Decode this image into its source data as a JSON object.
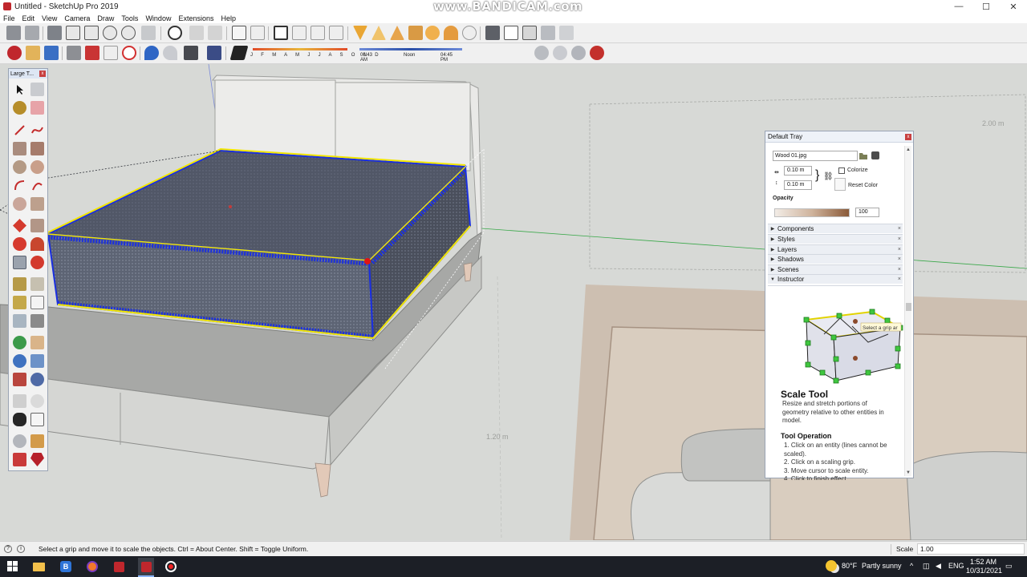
{
  "window": {
    "title": "Untitled - SketchUp Pro 2019",
    "watermark": "www.BANDICAM.com",
    "minimize": "—",
    "maximize": "☐",
    "close": "✕"
  },
  "menu": [
    "File",
    "Edit",
    "View",
    "Camera",
    "Draw",
    "Tools",
    "Window",
    "Extensions",
    "Help"
  ],
  "shadow_settings": {
    "months": "J F M A M J J A S O N D",
    "time_start": "06:43 AM",
    "time_mid": "Noon",
    "time_end": "04:45 PM"
  },
  "viewport": {
    "dimension_top": "2.00 m",
    "dimension_side": "1.20 m"
  },
  "tool_palette": {
    "title": "Large T..."
  },
  "tray": {
    "title": "Default Tray",
    "texture_name": "Wood 01.jpg",
    "width_value": "0.10 m",
    "height_value": "0.10 m",
    "colorize_label": "Colorize",
    "reset_color_label": "Reset Color",
    "opacity_label": "Opacity",
    "opacity_value": "100",
    "panels": [
      "Components",
      "Styles",
      "Layers",
      "Shadows",
      "Scenes",
      "Instructor"
    ],
    "instructor": {
      "tooltip": "Select a grip ar",
      "title": "Scale Tool",
      "description": "Resize and stretch portions of geometry relative to other entities in model.",
      "operation_title": "Tool Operation",
      "steps": [
        "1. Click on an entity (lines cannot be scaled).",
        "2. Click on a scaling grip.",
        "3. Move cursor to scale entity.",
        "4. Click to finish effect."
      ]
    }
  },
  "status_bar": {
    "message": "Select a grip and move it to scale the objects. Ctrl = About Center. Shift = Toggle Uniform.",
    "scale_label": "Scale",
    "scale_value": "1.00"
  },
  "taskbar": {
    "weather_temp": "80°F",
    "weather_text": "Partly sunny",
    "language": "ENG",
    "time": "1:52 AM",
    "date": "10/31/2021"
  },
  "colors": {
    "selection_blue": "#1a2fe0",
    "highlight_yellow": "#f2e600",
    "face_grey": "#5d6474",
    "sketchup_red": "#c0272d"
  }
}
